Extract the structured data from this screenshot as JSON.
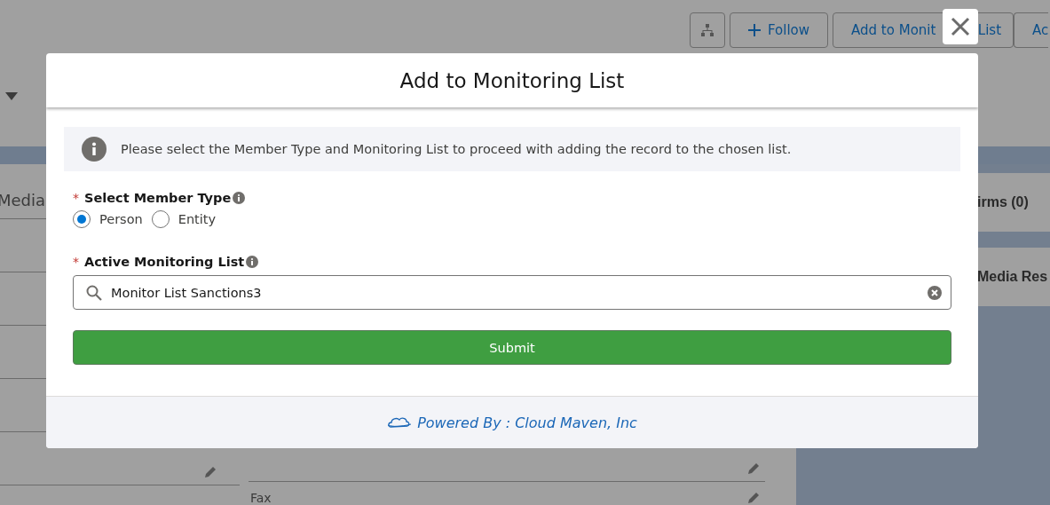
{
  "background": {
    "actions": {
      "follow": "Follow",
      "monitor_parts": [
        "Add to Monit",
        "List"
      ],
      "cut_button": "Ac"
    },
    "tab": "Media",
    "cards": [
      "irms (0)",
      "Media Res"
    ],
    "field_label": "Fax"
  },
  "modal": {
    "title": "Add to Monitoring List",
    "notice": "Please select the Member Type and Monitoring List to proceed with adding the record to the chosen list.",
    "member_type": {
      "label": "Select Member Type",
      "required_marker": "*",
      "options": [
        {
          "label": "Person",
          "selected": true
        },
        {
          "label": "Entity",
          "selected": false
        }
      ]
    },
    "monitoring_list": {
      "label": "Active Monitoring List",
      "required_marker": "*",
      "value": "Monitor List Sanctions3"
    },
    "submit": "Submit",
    "footer": "Powered By : Cloud Maven, Inc"
  }
}
